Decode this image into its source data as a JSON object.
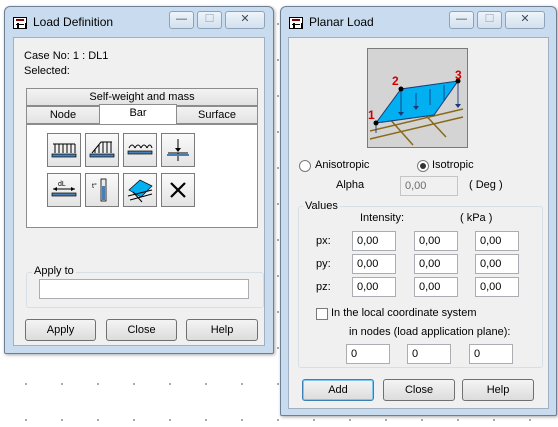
{
  "load_definition": {
    "title": "Load Definition",
    "case_label": "Case No: 1 : DL1",
    "selected_label": "Selected:",
    "tab_top": "Self-weight and mass",
    "tabs": [
      "Node",
      "Bar",
      "Surface"
    ],
    "active_tab": "Bar",
    "tool_icons": [
      "uniform-load-icon",
      "trapezoidal-load-icon",
      "moment-load-icon",
      "point-load-icon",
      "dilatation-icon",
      "thermal-load-icon",
      "planar-load-icon",
      "delete-icon"
    ],
    "apply_to_label": "Apply to",
    "apply_to_value": "",
    "buttons": {
      "apply": "Apply",
      "close": "Close",
      "help": "Help"
    }
  },
  "planar_load": {
    "title": "Planar Load",
    "diagram_labels": [
      "1",
      "2",
      "3"
    ],
    "options": {
      "anisotropic": "Anisotropic",
      "isotropic": "Isotropic",
      "selected": "isotropic"
    },
    "alpha_label": "Alpha",
    "alpha_value": "0,00",
    "alpha_unit": "( Deg )",
    "values_label": "Values",
    "intensity_label": "Intensity:",
    "unit_label": "( kPa )",
    "rows": [
      {
        "label": "px:",
        "values": [
          "0,00",
          "0,00",
          "0,00"
        ]
      },
      {
        "label": "py:",
        "values": [
          "0,00",
          "0,00",
          "0,00"
        ]
      },
      {
        "label": "pz:",
        "values": [
          "0,00",
          "0,00",
          "0,00"
        ]
      }
    ],
    "local_cs_label": "In the local coordinate system",
    "local_cs_checked": false,
    "nodes_label": "in nodes (load application plane):",
    "nodes": [
      "0",
      "0",
      "0"
    ],
    "buttons": {
      "add": "Add",
      "close": "Close",
      "help": "Help"
    }
  },
  "colors": {
    "frame": "#c9dcef",
    "client": "#f0f0f0",
    "load_plane": "#00b0f0",
    "label_red": "#d00000"
  }
}
